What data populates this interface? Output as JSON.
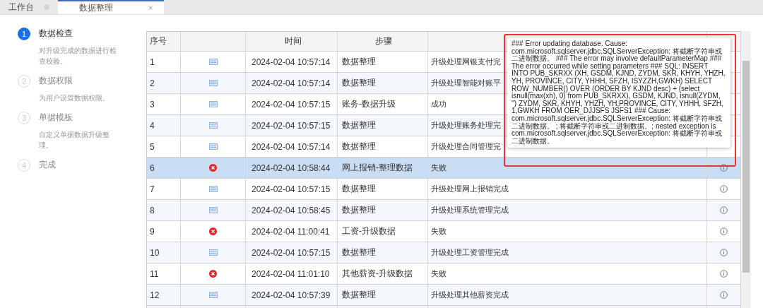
{
  "tabs": [
    {
      "label": "工作台",
      "selected": false,
      "closable": false
    },
    {
      "label": "数据整理",
      "selected": true,
      "closable": true,
      "close": "×"
    }
  ],
  "steps": [
    {
      "number": "1",
      "title": "数据检查",
      "description": "对升级完成的数据进行检查校验。",
      "active": true
    },
    {
      "number": "2",
      "title": "数据权限",
      "description": "为用户设置数据权限。",
      "active": false
    },
    {
      "number": "3",
      "title": "单据模板",
      "description": "自定义单据数据升级整理。",
      "active": false
    },
    {
      "number": "4",
      "title": "完成",
      "active": false
    }
  ],
  "table": {
    "columns": [
      "序号",
      "时间",
      "步骤"
    ],
    "rows": [
      {
        "index": "1",
        "kind": "message",
        "time": "2024-02-04 10:57:14",
        "step": "数据整理",
        "result": "升级处理网银支付完",
        "selected": false,
        "info": false
      },
      {
        "index": "2",
        "kind": "message",
        "time": "2024-02-04 10:57:14",
        "step": "数据整理",
        "result": "升级处理智能对账平",
        "selected": false,
        "info": false
      },
      {
        "index": "3",
        "kind": "message",
        "time": "2024-02-04 10:57:15",
        "step": "账务-数据升级",
        "result": "成功",
        "selected": false,
        "info": false
      },
      {
        "index": "4",
        "kind": "message",
        "time": "2024-02-04 10:57:15",
        "step": "数据整理",
        "result": "升级处理账务处理完",
        "selected": false,
        "info": false
      },
      {
        "index": "5",
        "kind": "message",
        "time": "2024-02-04 10:57:14",
        "step": "数据整理",
        "result": "升级处理合同管理完",
        "selected": false,
        "info": false
      },
      {
        "index": "6",
        "kind": "error",
        "time": "2024-02-04 10:58:44",
        "step": "网上报销-整理数据",
        "result": "失败",
        "selected": true,
        "info": true
      },
      {
        "index": "7",
        "kind": "message",
        "time": "2024-02-04 10:57:15",
        "step": "数据整理",
        "result": "升级处理网上报销完成",
        "selected": false,
        "info": true
      },
      {
        "index": "8",
        "kind": "message",
        "time": "2024-02-04 10:58:45",
        "step": "数据整理",
        "result": "升级处理系统管理完成",
        "selected": false,
        "info": true
      },
      {
        "index": "9",
        "kind": "error",
        "time": "2024-02-04 11:00:41",
        "step": "工资-升级数据",
        "result": "失败",
        "selected": false,
        "info": true
      },
      {
        "index": "10",
        "kind": "message",
        "time": "2024-02-04 10:57:15",
        "step": "数据整理",
        "result": "升级处理工资管理完成",
        "selected": false,
        "info": true
      },
      {
        "index": "11",
        "kind": "error",
        "time": "2024-02-04 11:01:10",
        "step": "其他薪资-升级数据",
        "result": "失败",
        "selected": false,
        "info": true
      },
      {
        "index": "12",
        "kind": "message",
        "time": "2024-02-04 10:57:39",
        "step": "数据整理",
        "result": "升级处理其他薪资完成",
        "selected": false,
        "info": true
      }
    ]
  },
  "tooltip": {
    "text": "### Error updating database. Cause: com.microsoft.sqlserver.jdbc.SQLServerException: 将截断字符串或二进制数据。 ### The error may involve defaultParameterMap ### The error occurred while setting parameters ### SQL: INSERT INTO PUB_SKRXX (XH, GSDM, KJND, ZYDM, SKR, KHYH, YHZH, YH, PROVINCE, CITY, YHHH, SFZH, ISYZZH,GWKH) SELECT ROW_NUMBER() OVER (ORDER BY KJND desc) + (select isnull(max(xh), 0) from PUB_SKRXX), GSDM, KJND, isnull(ZYDM, '') ZYDM, SKR, KHYH, YHZH, YH,PROVINCE, CITY, YHHH, SFZH, 1,GWKH FROM OER_DJJSFS JSFS1 ### Cause: com.microsoft.sqlserver.jdbc.SQLServerException: 将截断字符串或二进制数据。 ; 将截断字符串或二进制数据。; nested exception is com.microsoft.sqlserver.jdbc.SQLServerException: 将截断字符串或二进制数据。",
    "highlighted": true
  }
}
